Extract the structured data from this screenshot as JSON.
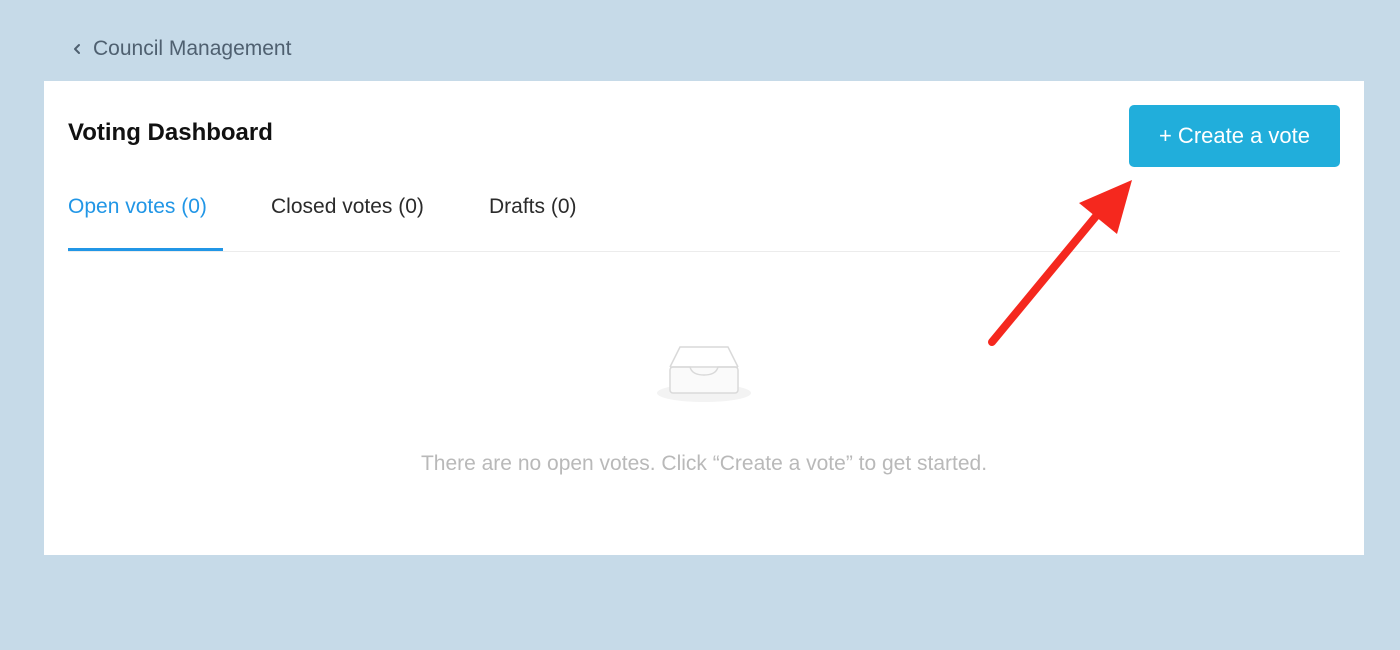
{
  "breadcrumb": {
    "label": "Council Management",
    "icon": "chevron-left-icon"
  },
  "dashboard": {
    "title": "Voting Dashboard",
    "create_button": "+ Create a vote"
  },
  "tabs": [
    {
      "label": "Open votes (0)",
      "active": true
    },
    {
      "label": "Closed votes (0)",
      "active": false
    },
    {
      "label": "Drafts (0)",
      "active": false
    }
  ],
  "empty_state": {
    "icon": "empty-inbox-icon",
    "message": "There are no open votes. Click “Create a vote” to get started."
  },
  "colors": {
    "background": "#c6dae8",
    "accent": "#2196e6",
    "button": "#21aedb",
    "annotation_arrow": "#f5281e"
  }
}
